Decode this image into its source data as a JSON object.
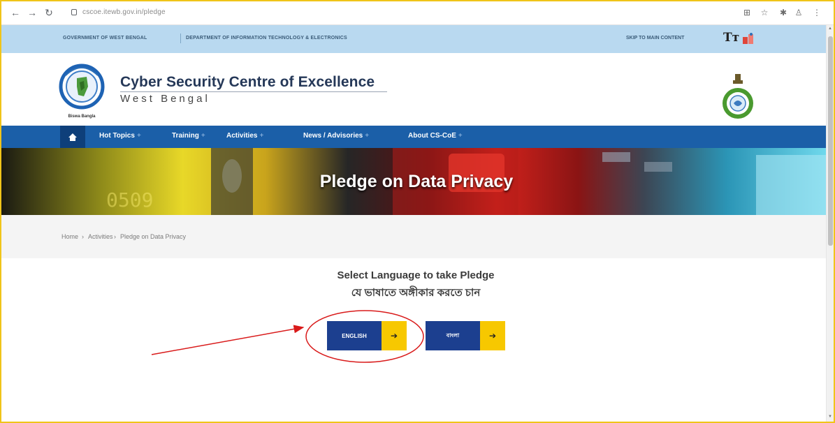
{
  "browser": {
    "url": "cscoe.itewb.gov.in/pledge"
  },
  "gov_strip": {
    "left_1": "GOVERNMENT OF WEST BENGAL",
    "left_2": "DEPARTMENT OF INFORMATION TECHNOLOGY & ELECTRONICS",
    "skip": "SKIP TO MAIN CONTENT",
    "text_size": "Tт"
  },
  "header": {
    "title": "Cyber Security Centre of Excellence",
    "subtitle": "West Bengal",
    "logo_caption": "Biswa Bangla"
  },
  "nav": {
    "items": [
      {
        "label": "Hot Topics"
      },
      {
        "label": "Training"
      },
      {
        "label": "Activities"
      },
      {
        "label": "News / Advisories"
      },
      {
        "label": "About CS-CoE"
      }
    ],
    "chevron": "+"
  },
  "banner": {
    "title": "Pledge on Data Privacy",
    "digits": "0509"
  },
  "breadcrumb": {
    "home": "Home",
    "activities": "Activities",
    "current": "Pledge on Data Privacy",
    "sep": "›"
  },
  "main": {
    "heading_en": "Select Language to take Pledge",
    "heading_bn": "যে ভাষাতে অঙ্গীকার করতে চান",
    "buttons": [
      {
        "label": "ENGLISH",
        "arrow": "➔"
      },
      {
        "label": "বাংলা",
        "arrow": "➔"
      }
    ]
  },
  "colors": {
    "nav_blue": "#1b5fa8",
    "button_blue": "#1c3f8f",
    "button_yellow": "#f7c800",
    "gov_strip": "#b9d9f0",
    "annotation_red": "#d91a1a",
    "frame_border": "#f0c419"
  }
}
